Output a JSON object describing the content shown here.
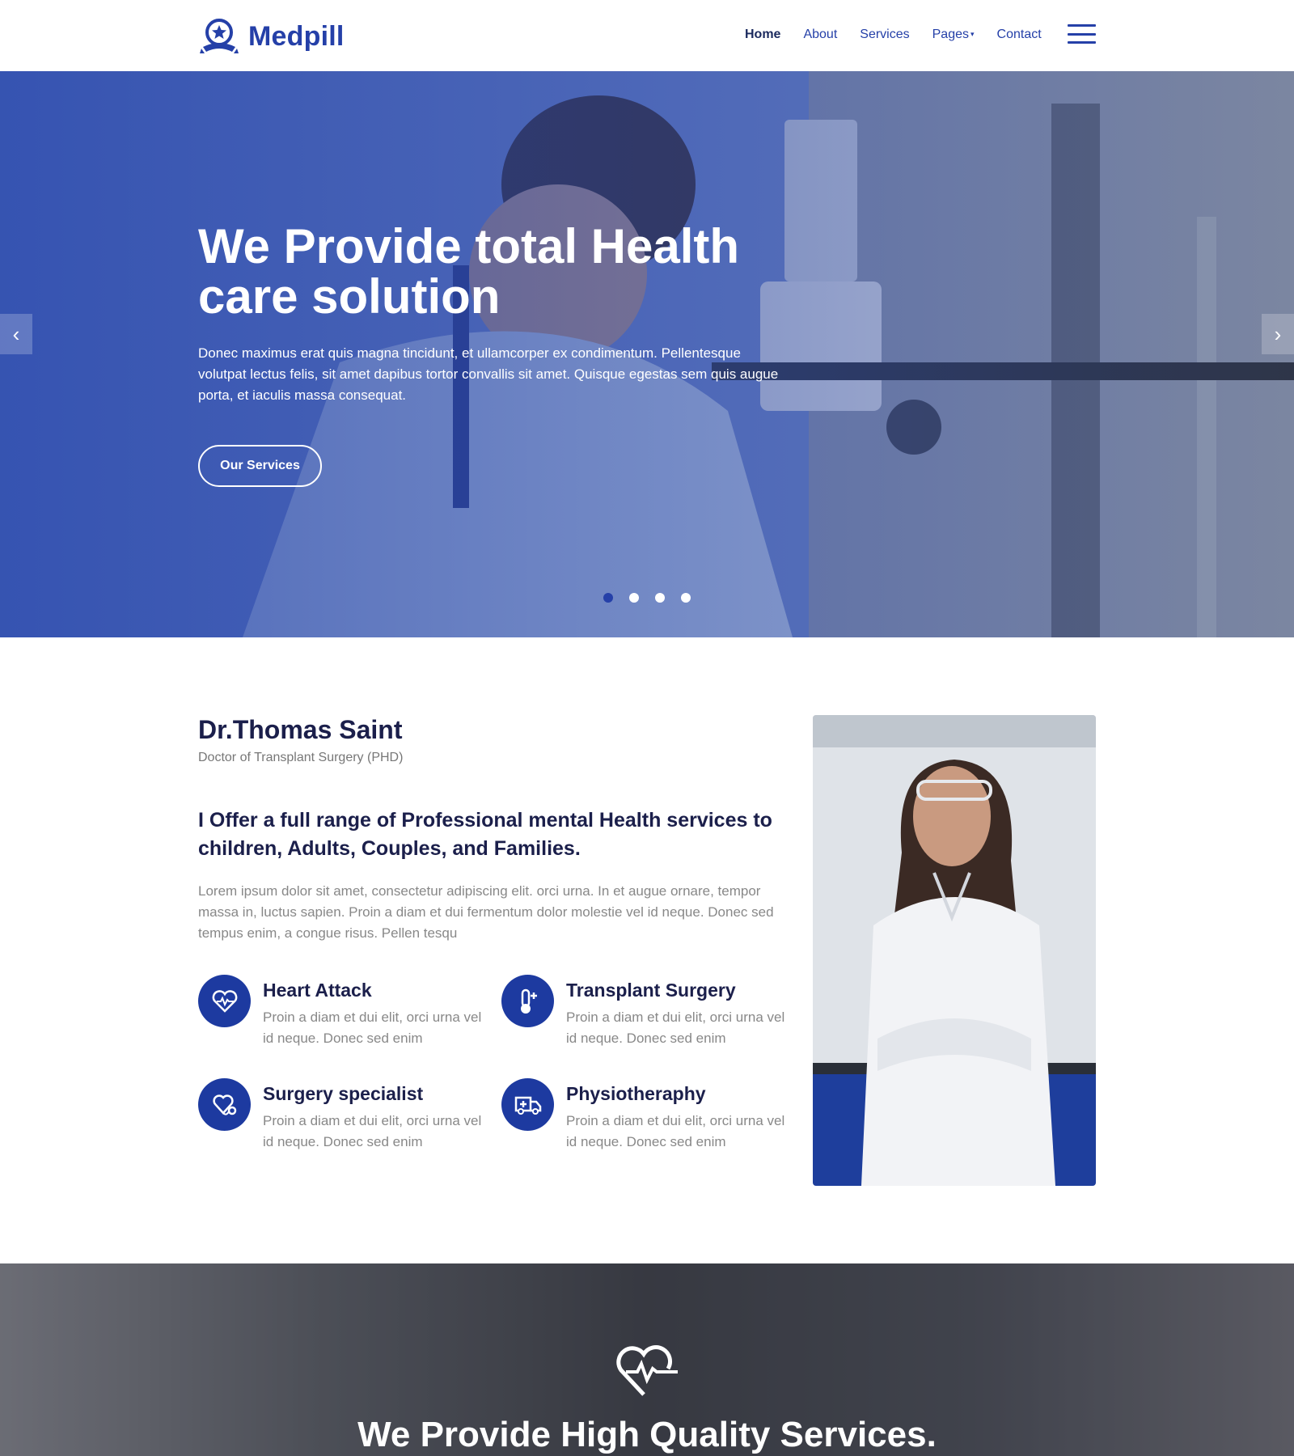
{
  "brand": {
    "name": "Medpill",
    "color": "#2540a8"
  },
  "nav": {
    "items": [
      {
        "label": "Home",
        "active": true
      },
      {
        "label": "About"
      },
      {
        "label": "Services"
      },
      {
        "label": "Pages",
        "caret": "▾"
      },
      {
        "label": "Contact"
      }
    ],
    "menu_icon": "hamburger-icon"
  },
  "hero": {
    "title": "We Provide total Health care solution",
    "text": "Donec maximus erat quis magna tincidunt, et ullamcorper ex condimentum. Pellentesque volutpat lectus felis, sit amet dapibus tortor convallis sit amet. Quisque egestas sem quis augue porta, et iaculis massa consequat.",
    "button": "Our Services",
    "prev_arrow": "‹",
    "next_arrow": "›",
    "slides": 4,
    "active_slide": 1
  },
  "doctor": {
    "name": "Dr.Thomas Saint",
    "role": "Doctor of Transplant Surgery (PHD)",
    "headline": "I Offer a full range of Professional mental Health services to children, Adults, Couples, and Families.",
    "text": "Lorem ipsum dolor sit amet, consectetur adipiscing elit. orci urna. In et augue ornare, tempor massa in, luctus sapien. Proin a diam et dui fermentum dolor molestie vel id neque. Donec sed tempus enim, a congue risus. Pellen tesqu"
  },
  "features": [
    {
      "title": "Heart Attack",
      "text": "Proin a diam et dui elit, orci urna vel id neque. Donec sed enim",
      "icon": "heartbeat-icon"
    },
    {
      "title": "Transplant Surgery",
      "text": "Proin a diam et dui elit, orci urna vel id neque. Donec sed enim",
      "icon": "thermometer-icon"
    },
    {
      "title": "Surgery specialist",
      "text": "Proin a diam et dui elit, orci urna vel id neque. Donec sed enim",
      "icon": "stethoscope-heart-icon"
    },
    {
      "title": "Physiotheraphy",
      "text": "Proin a diam et dui elit, orci urna vel id neque. Donec sed enim",
      "icon": "ambulance-icon"
    }
  ],
  "banner": {
    "title": "We Provide High Quality Services.",
    "icon": "heartbeat-icon"
  },
  "colors": {
    "primary": "#2540a8",
    "dark_text": "#1b1f4b",
    "muted_text": "#888888",
    "icon_circle": "#1d3aa0"
  }
}
